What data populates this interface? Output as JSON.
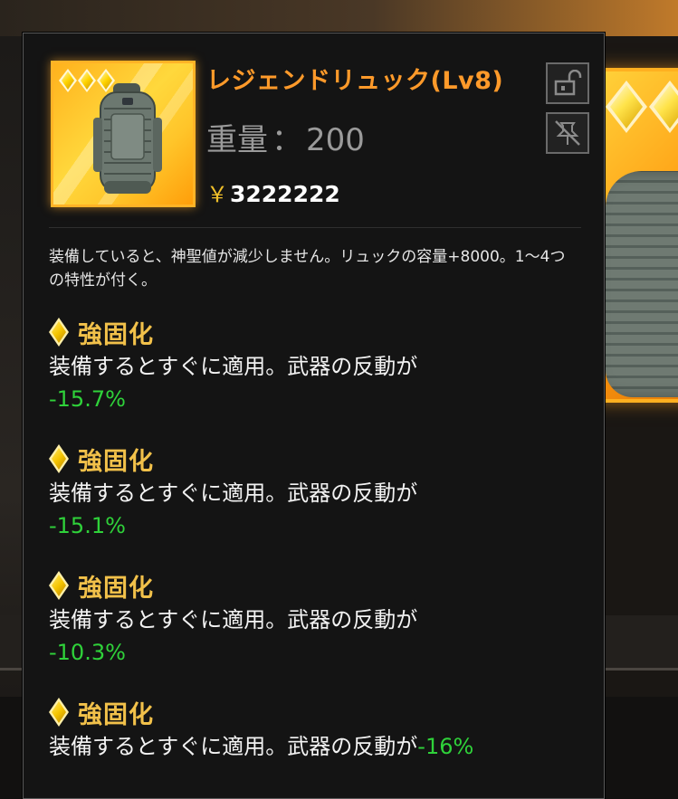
{
  "item": {
    "title": "レジェンドリュック(Lv8)",
    "weight_label": "重量",
    "weight_sep": "：",
    "weight_value": "200",
    "currency_symbol": "￥",
    "price": "3222222",
    "rarity_diamonds": 3,
    "rarity_color": "#ffb326",
    "description": "装備していると、神聖値が減少しません。リュックの容量+8000。1〜4つの特性が付く。"
  },
  "actions": {
    "lock_icon": "lock-open-icon",
    "pin_icon": "pin-off-icon"
  },
  "traits": [
    {
      "name": "強固化",
      "text": "装備するとすぐに適用。武器の反動が",
      "value": "-15.7%"
    },
    {
      "name": "強固化",
      "text": "装備するとすぐに適用。武器の反動が",
      "value": "-15.1%"
    },
    {
      "name": "強固化",
      "text": "装備するとすぐに適用。武器の反動が",
      "value": "-10.3%"
    },
    {
      "name": "強固化",
      "text": "装備するとすぐに適用。武器の反動が",
      "value": "-16%"
    }
  ],
  "colors": {
    "title": "#ff9a2a",
    "trait_name": "#f2c14a",
    "positive_value": "#2fd23a"
  }
}
